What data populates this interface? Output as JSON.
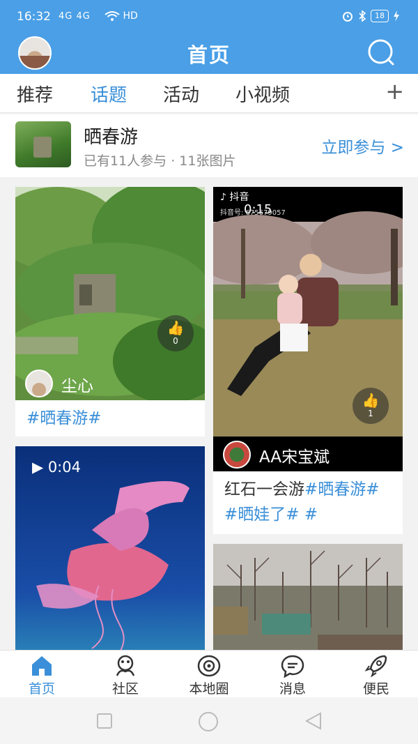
{
  "status": {
    "time": "16:32",
    "signal": "4G  4G",
    "network": "HD",
    "battery": "18"
  },
  "header": {
    "title": "首页"
  },
  "tabs": [
    {
      "label": "推荐"
    },
    {
      "label": "话题"
    },
    {
      "label": "活动"
    },
    {
      "label": "小视频"
    }
  ],
  "tab_add_label": "+",
  "topic": {
    "title": "晒春游",
    "subtitle": "已有11人参与 · 11张图片",
    "join_label": "立即参与 >"
  },
  "cards": [
    {
      "user": "尘心",
      "likes": "0",
      "caption_tag": "#晒春游#"
    },
    {
      "video_badge": "抖音",
      "duration": "0:15",
      "watermark": "抖音号: 675679057",
      "likes": "1",
      "user": "AA宋宝斌",
      "caption_text": "红石一会游",
      "caption_tags": "#晒春游# #晒娃了# #"
    },
    {
      "duration": "▶ 0:04"
    },
    {}
  ],
  "bottom_nav": [
    {
      "label": "首页",
      "icon": "home-icon"
    },
    {
      "label": "社区",
      "icon": "community-icon"
    },
    {
      "label": "本地圈",
      "icon": "local-circle-icon"
    },
    {
      "label": "消息",
      "icon": "message-icon"
    },
    {
      "label": "便民",
      "icon": "rocket-icon"
    }
  ],
  "colors": {
    "primary": "#4a9fe6",
    "accent": "#3a8fd8"
  }
}
